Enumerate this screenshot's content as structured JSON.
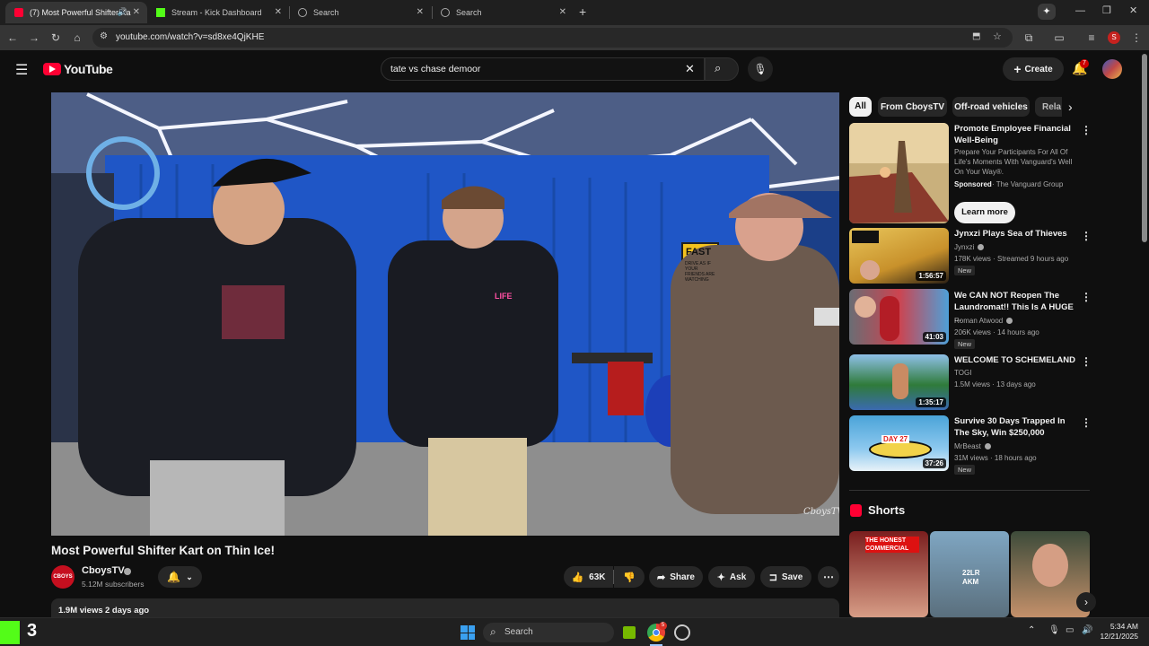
{
  "browser": {
    "tabs": [
      {
        "title": "(7) Most Powerful Shifter Ka",
        "active": true
      },
      {
        "title": "Stream - Kick Dashboard",
        "active": false
      },
      {
        "title": "Search",
        "active": false
      },
      {
        "title": "Search",
        "active": false
      }
    ],
    "new_tab": "+",
    "url": "youtube.com/watch?v=sd8xe4QjKHE",
    "profile_initial": "S"
  },
  "youtube": {
    "logo_text": "YouTube",
    "search_value": "tate vs chase demoor",
    "create_label": "Create",
    "notif_count": "7"
  },
  "video": {
    "watermark": "CboysTV",
    "sign_line1": "FAST",
    "sign_line2": "DRIVE AS IF YOUR FRIENDS ARE WATCHING",
    "shirt_text": "LIFE",
    "title": "Most Powerful Shifter Kart on Thin Ice!",
    "channel": "CboysTV",
    "channel_avatar": "CBOYS",
    "subscribers": "5.12M subscribers",
    "likes": "63K",
    "share": "Share",
    "ask": "Ask",
    "save": "Save",
    "views": "1.9M views",
    "age": "2 days ago"
  },
  "chips": [
    "All",
    "From CboysTV",
    "Off-road vehicles",
    "Rela"
  ],
  "ad": {
    "title": "Promote Employee Financial Well-Being",
    "desc": "Prepare Your Participants For All Of Life's Moments With Vanguard's Well On Your Way®.",
    "sponsored": "Sponsored",
    "advertiser": "· The Vanguard Group",
    "cta": "Learn more"
  },
  "recs": [
    {
      "title": "Jynxzi Plays Sea of Thieves",
      "channel": "Jynxzi",
      "meta": "178K views · Streamed 9 hours ago",
      "duration": "1:56:57",
      "badge": "New"
    },
    {
      "title": "We CAN NOT Reopen The Laundromat!! This Is A HUGE ...",
      "channel": "Roman Atwood",
      "meta": "206K views · 14 hours ago",
      "duration": "41:03",
      "badge": "New"
    },
    {
      "title": "WELCOME TO SCHEMELAND",
      "channel": "TOGI",
      "meta": "1.5M views · 13 days ago",
      "duration": "1:35:17",
      "badge": ""
    },
    {
      "title": "Survive 30 Days Trapped In The Sky, Win $250,000",
      "channel": "MrBeast",
      "meta": "31M views · 18 hours ago",
      "duration": "37:26",
      "badge": "New"
    }
  ],
  "rec_thumb_text": {
    "mrbeast_day": "DAY 27"
  },
  "shorts": {
    "heading": "Shorts",
    "items": [
      {
        "overlay": "THE HONEST COMMERCIAL"
      },
      {
        "overlay": "22LR AKM"
      },
      {
        "overlay": ""
      }
    ]
  },
  "taskbar": {
    "kick_count": "3",
    "search_placeholder": "Search",
    "time": "5:34 AM",
    "date": "12/21/2025",
    "chrome_badge": "5"
  },
  "colors": {
    "accent_red": "#ff0033",
    "kick_green": "#53fc18",
    "yt_bg": "#0f0f0f"
  }
}
